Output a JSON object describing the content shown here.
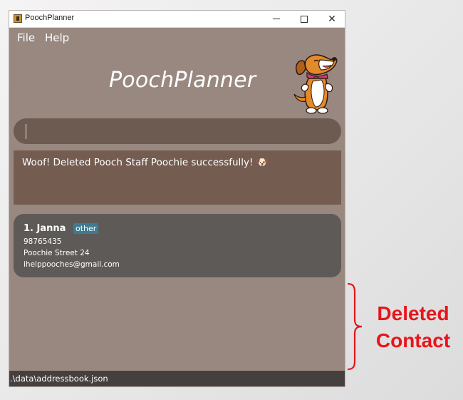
{
  "window": {
    "title": "PoochPlanner",
    "controls": {
      "minimize": "minimize-icon",
      "maximize": "maximize-icon",
      "close": "close-icon"
    }
  },
  "menu": {
    "items": [
      "File",
      "Help"
    ]
  },
  "header": {
    "title": "PoochPlanner",
    "mascot": "dog-mascot-icon"
  },
  "command": {
    "value": "",
    "placeholder": ""
  },
  "result": {
    "message": "Woof! Deleted Pooch Staff Poochie successfully! 🐶"
  },
  "contacts": [
    {
      "index_name": "1.  Janna",
      "tag": "other",
      "phone": "98765435",
      "address": "Poochie Street 24",
      "email": "ihelppooches@gmail.com"
    }
  ],
  "status": {
    "path": ".\\data\\addressbook.json"
  },
  "annotation": {
    "line1": "Deleted",
    "line2": "Contact"
  },
  "colors": {
    "window_bg": "#988880",
    "command_bg": "#6d5a51",
    "result_bg": "#745c51",
    "card_bg": "#5e5a57",
    "tag_bg": "#3e7b91",
    "status_bg": "#45403e",
    "annotation": "#e8141c"
  }
}
